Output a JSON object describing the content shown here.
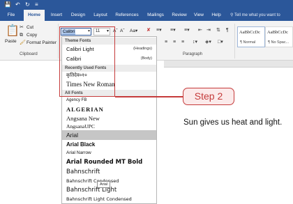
{
  "quick_access": [
    "save-icon",
    "undo-icon",
    "redo-icon",
    "customize-icon"
  ],
  "tabs": [
    {
      "label": "File"
    },
    {
      "label": "Home"
    },
    {
      "label": "Insert"
    },
    {
      "label": "Design"
    },
    {
      "label": "Layout"
    },
    {
      "label": "References"
    },
    {
      "label": "Mailings"
    },
    {
      "label": "Review"
    },
    {
      "label": "View"
    },
    {
      "label": "Help"
    }
  ],
  "tell_me": "Tell me what you want to",
  "clipboard": {
    "paste_label": "Paste",
    "cut_label": "Cut",
    "copy_label": "Copy",
    "format_painter_label": "Format Painter",
    "group_label": "Clipboard"
  },
  "font": {
    "name_value": "Calibri",
    "size_value": "11"
  },
  "paragraph": {
    "group_label": "Paragraph"
  },
  "styles": [
    {
      "preview": "AaBbCcDc",
      "name": "¶ Normal"
    },
    {
      "preview": "AaBbCcDc",
      "name": "¶ No Spac..."
    }
  ],
  "font_list": {
    "theme_header": "Theme Fonts",
    "theme_fonts": [
      {
        "name": "Calibri Light",
        "tag": "(Headings)"
      },
      {
        "name": "Calibri",
        "tag": "(Body)"
      }
    ],
    "recent_header": "Recently Used Fonts",
    "recent_fonts": [
      "कृतिदेव०१०",
      "Times New Roman"
    ],
    "all_header": "All Fonts",
    "all_fonts": [
      "Agency FB",
      "ALGERIAN",
      "Angsana New",
      "AngsanaUPC",
      "Arial",
      "Arial Black",
      "Arial Narrow",
      "Arial Rounded MT Bold",
      "Bahnschrift",
      "Bahnschrift Condensed",
      "Bahnschrift Light",
      "Bahnschrift Light Condensed"
    ],
    "hovered_index": 4
  },
  "tooltip": "Arial",
  "callout": "Step 2",
  "document": {
    "text": "Sun gives us heat and light."
  },
  "colors": {
    "ribbon_blue": "#2b579a",
    "callout_red": "#c53a3a",
    "hover_gray": "#c6c6c6"
  }
}
